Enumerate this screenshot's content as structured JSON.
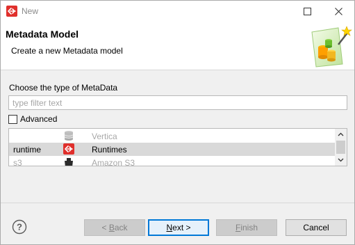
{
  "window": {
    "title": "New",
    "icon": "talend-app-icon"
  },
  "header": {
    "title": "Metadata Model",
    "description": "Create a new Metadata model",
    "graphic": "metadata-wizard-graphic"
  },
  "body": {
    "section_label": "Choose the type of MetaData",
    "filter_placeholder": "type filter text",
    "filter_value": "",
    "advanced_label": "Advanced",
    "advanced_checked": false
  },
  "list": {
    "rows": [
      {
        "id": "",
        "name": "Vertica",
        "icon": "database-icon",
        "state": "disabled"
      },
      {
        "id": "runtime",
        "name": "Runtimes",
        "icon": "runtime-icon",
        "state": "selected"
      },
      {
        "id": "s3",
        "name": "Amazon S3",
        "icon": "s3-bucket-icon",
        "state": "disabled"
      }
    ]
  },
  "footer": {
    "back_prefix": "< ",
    "back_mnemonic": "B",
    "back_rest": "ack",
    "next_mnemonic": "N",
    "next_rest": "ext >",
    "finish_mnemonic": "F",
    "finish_rest": "inish",
    "cancel_label": "Cancel"
  },
  "colors": {
    "selection": "#d9d9d9",
    "default_button_border": "#0078d7",
    "disabled_text": "#a8a8a8"
  }
}
